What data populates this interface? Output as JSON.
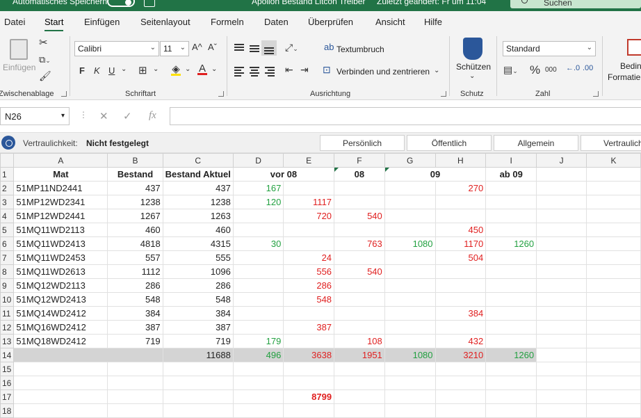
{
  "titlebar": {
    "autosave": "Automatisches Speichern",
    "filename": "Apollon Bestand Litcon Treiber",
    "saved": "Zuletzt geändert: Fr um 11:04",
    "search": "Suchen"
  },
  "tabs": [
    "Datei",
    "Start",
    "Einfügen",
    "Seitenlayout",
    "Formeln",
    "Daten",
    "Überprüfen",
    "Ansicht",
    "Hilfe"
  ],
  "active_tab": "Start",
  "ribbon": {
    "clipboard": {
      "label": "Zwischenablage",
      "paste": "Einfügen"
    },
    "font": {
      "label": "Schriftart",
      "name": "Calibri",
      "size": "11",
      "bold": "F",
      "italic": "K",
      "underline": "U",
      "grow": "A^",
      "shrink": "Aˇ"
    },
    "alignment": {
      "label": "Ausrichtung",
      "wrap": "Textumbruch",
      "merge": "Verbinden und zentrieren"
    },
    "protect": {
      "label": "Schutz",
      "button": "Schützen"
    },
    "number": {
      "label": "Zahl",
      "format": "Standard",
      "percent": "%",
      "thousands": "000"
    },
    "conditional": {
      "line1": "Bedin",
      "line2": "Formatie"
    }
  },
  "formulabar": {
    "namebox": "N26",
    "fx": "fx",
    "formula": ""
  },
  "sensitivity": {
    "label": "Vertraulichkeit:",
    "value": "Nicht festgelegt",
    "buttons": [
      "Persönlich",
      "Öffentlich",
      "Allgemein",
      "Vertraulich"
    ]
  },
  "sheet": {
    "columns": [
      "A",
      "B",
      "C",
      "D",
      "E",
      "F",
      "G",
      "H",
      "I",
      "J",
      "K"
    ],
    "header": {
      "A": "Mat",
      "B": "Bestand",
      "C": "Bestand Aktuel",
      "DE": "vor 08",
      "F": "08",
      "GH": "09",
      "I": "ab 09"
    },
    "rows": [
      {
        "n": "2",
        "A": "51MP11ND2441",
        "B": "437",
        "C": "437",
        "D": "167",
        "E": "",
        "F": "",
        "G": "",
        "H": "270",
        "I": ""
      },
      {
        "n": "3",
        "A": "51MP12WD2341",
        "B": "1238",
        "C": "1238",
        "D": "120",
        "E": "1117",
        "F": "",
        "G": "",
        "H": "",
        "I": ""
      },
      {
        "n": "4",
        "A": "51MP12WD2441",
        "B": "1267",
        "C": "1263",
        "D": "",
        "E": "720",
        "F": "540",
        "G": "",
        "H": "",
        "I": ""
      },
      {
        "n": "5",
        "A": "51MQ11WD2113",
        "B": "460",
        "C": "460",
        "D": "",
        "E": "",
        "F": "",
        "G": "",
        "H": "450",
        "I": ""
      },
      {
        "n": "6",
        "A": "51MQ11WD2413",
        "B": "4818",
        "C": "4315",
        "D": "30",
        "E": "",
        "F": "763",
        "G": "1080",
        "H": "1170",
        "I": "1260"
      },
      {
        "n": "7",
        "A": "51MQ11WD2453",
        "B": "557",
        "C": "555",
        "D": "",
        "E": "24",
        "F": "",
        "G": "",
        "H": "504",
        "I": ""
      },
      {
        "n": "8",
        "A": "51MQ11WD2613",
        "B": "1112",
        "C": "1096",
        "D": "",
        "E": "556",
        "F": "540",
        "G": "",
        "H": "",
        "I": ""
      },
      {
        "n": "9",
        "A": "51MQ12WD2113",
        "B": "286",
        "C": "286",
        "D": "",
        "E": "286",
        "F": "",
        "G": "",
        "H": "",
        "I": ""
      },
      {
        "n": "10",
        "A": "51MQ12WD2413",
        "B": "548",
        "C": "548",
        "D": "",
        "E": "548",
        "F": "",
        "G": "",
        "H": "",
        "I": ""
      },
      {
        "n": "11",
        "A": "51MQ14WD2412",
        "B": "384",
        "C": "384",
        "D": "",
        "E": "",
        "F": "",
        "G": "",
        "H": "384",
        "I": ""
      },
      {
        "n": "12",
        "A": "51MQ16WD2412",
        "B": "387",
        "C": "387",
        "D": "",
        "E": "387",
        "F": "",
        "G": "",
        "H": "",
        "I": ""
      },
      {
        "n": "13",
        "A": "51MQ18WD2412",
        "B": "719",
        "C": "719",
        "D": "179",
        "E": "",
        "F": "108",
        "G": "",
        "H": "432",
        "I": ""
      }
    ],
    "total": {
      "n": "14",
      "C": "11688",
      "D": "496",
      "E": "3638",
      "F": "1951",
      "G": "1080",
      "H": "3210",
      "I": "1260"
    },
    "empty_rows": [
      "15",
      "16",
      "18"
    ],
    "row17": {
      "n": "17",
      "E": "8799"
    },
    "colors": {
      "positive": "#22a040",
      "negative": "#e02020",
      "total_bg": "#d4d4d4",
      "accent": "#217346"
    }
  }
}
